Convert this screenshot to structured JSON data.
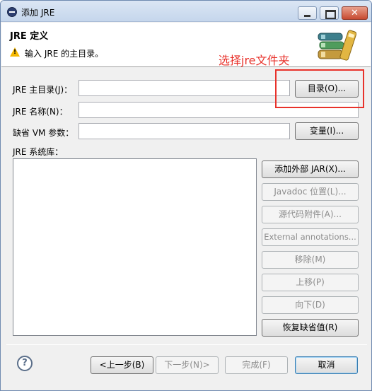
{
  "window": {
    "title": "添加 JRE"
  },
  "banner": {
    "title": "JRE 定义",
    "message": "输入 JRE 的主目录。",
    "annotation": "选择jre文件夹"
  },
  "form": {
    "home_label": "JRE 主目录(J)：",
    "home_value": "",
    "directory_button": "目录(O)...",
    "name_label": "JRE 名称(N)：",
    "name_value": "",
    "vm_args_label": "缺省 VM 参数：",
    "vm_args_value": "",
    "variables_button": "变量(I)...",
    "libraries_label": "JRE 系统库："
  },
  "library_buttons": {
    "add_external_jar": "添加外部 JAR(X)...",
    "javadoc_location": "Javadoc 位置(L)...",
    "source_attachment": "源代码附件(A)...",
    "external_annotations": "External annotations...",
    "remove": "移除(M)",
    "up": "上移(P)",
    "down": "向下(D)",
    "restore_default": "恢复缺省值(R)"
  },
  "footer": {
    "back": "<上一步(B)",
    "next": "下一步(N)>",
    "finish": "完成(F)",
    "cancel": "取消"
  },
  "icons": {
    "app": "eclipse-icon",
    "warning": "warning-icon",
    "banner_art": "library-books-icon",
    "help": "help-icon"
  },
  "colors": {
    "annotation_red": "#e8322b",
    "warning_yellow": "#f5b800",
    "titlebar": "#c5d6ec"
  }
}
